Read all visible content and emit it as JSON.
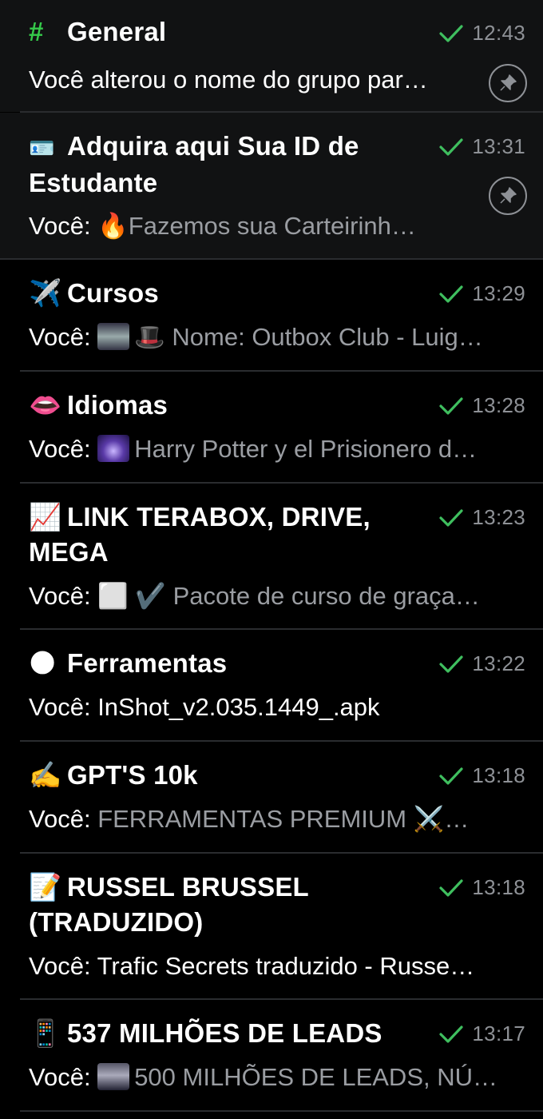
{
  "chats": [
    {
      "emoji": "#",
      "title": "General",
      "time": "12:43",
      "you": "",
      "message": "Você alterou o nome do grupo par…",
      "pinned": true
    },
    {
      "emoji": "🪪",
      "title": "Adquira aqui Sua ID de Estudante",
      "time": "13:31",
      "you": "Você: ",
      "message": "🔥Fazemos sua Carteirinh…",
      "pinned": true
    },
    {
      "emoji": "✈️",
      "title": "Cursos",
      "time": "13:29",
      "you": "Você: ",
      "message": "🎩 Nome: Outbox Club - Luig…",
      "pinned": false
    },
    {
      "emoji": "👄",
      "title": "Idiomas",
      "time": "13:28",
      "you": "Você: ",
      "message": "Harry Potter y el Prisionero d…",
      "pinned": false
    },
    {
      "emoji": "📈",
      "title": "LINK TERABOX, DRIVE, MEGA",
      "time": "13:23",
      "you": "Você: ",
      "message": "⬜ ✔️ Pacote de curso de graça…",
      "pinned": false
    },
    {
      "emoji": "🌑",
      "title": "Ferramentas",
      "time": "13:22",
      "you": "Você: ",
      "message": "InShot_v2.035.1449_.apk",
      "pinned": false
    },
    {
      "emoji": "✍️",
      "title": "GPT'S 10k",
      "time": "13:18",
      "you": "Você: ",
      "message": "FERRAMENTAS PREMIUM ⚔️…",
      "pinned": false
    },
    {
      "emoji": "📝",
      "title": "RUSSEL BRUSSEL (TRADUZIDO)",
      "time": "13:18",
      "you": "Você: ",
      "message": "Trafic Secrets traduzido - Russe…",
      "pinned": false
    },
    {
      "emoji": "📱",
      "title": "537 MILHÕES DE LEADS",
      "time": "13:17",
      "you": "Você: ",
      "message": "500 MILHÕES DE LEADS, NÚ…",
      "pinned": false
    }
  ],
  "colors": {
    "check": "#3fbf5f",
    "hash": "#35c94a",
    "time": "#8e9196",
    "preview": "#9a9da2"
  },
  "icons": {
    "read_receipt": "check-icon",
    "pin": "pin-icon"
  }
}
